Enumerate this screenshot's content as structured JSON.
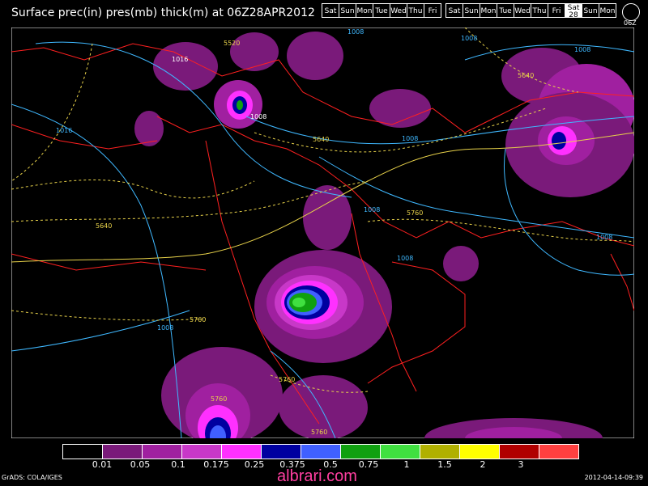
{
  "title": "Surface prec(in) pres(mb) thick(m) at 06Z28APR2012",
  "days": [
    {
      "label": "Sat",
      "current": false
    },
    {
      "label": "Sun",
      "current": false
    },
    {
      "label": "Mon",
      "current": false
    },
    {
      "label": "Tue",
      "current": false
    },
    {
      "label": "Wed",
      "current": false
    },
    {
      "label": "Thu",
      "current": false
    },
    {
      "label": "Fri",
      "current": false
    },
    {
      "label": "Sat",
      "current": false
    },
    {
      "label": "Sun",
      "current": false
    },
    {
      "label": "Mon",
      "current": false
    },
    {
      "label": "Tue",
      "current": false
    },
    {
      "label": "Wed",
      "current": false
    },
    {
      "label": "Thu",
      "current": false
    },
    {
      "label": "Fri",
      "current": false
    },
    {
      "label": "Sat",
      "current": true,
      "sub": "28"
    },
    {
      "label": "Sun",
      "current": false
    },
    {
      "label": "Mon",
      "current": false
    }
  ],
  "dial_label": "06Z",
  "map": {
    "isobar_labels": [
      "1016",
      "1016",
      "1008",
      "1008",
      "1008",
      "1008",
      "1008",
      "1008",
      "1008",
      "1008",
      "1008"
    ],
    "thickness_labels": [
      "5520",
      "5640",
      "5640",
      "5640",
      "5760",
      "5760",
      "5760",
      "5760",
      "5760"
    ],
    "colors": {
      "isobar": "#3fb8ff",
      "thickness": "#e8d24a",
      "coast": "#ff2020"
    }
  },
  "legend": {
    "colors": [
      "#000000",
      "#7a1a7a",
      "#a020a0",
      "#c838c8",
      "#ff30ff",
      "#0000a0",
      "#4060ff",
      "#10a010",
      "#40e040",
      "#b0b000",
      "#ffff00",
      "#b00000",
      "#ff4040"
    ],
    "labels": [
      "0.01",
      "0.05",
      "0.1",
      "0.175",
      "0.25",
      "0.375",
      "0.5",
      "0.75",
      "1",
      "1.5",
      "2",
      "3"
    ]
  },
  "footer": {
    "left": "GrADS: COLA/IGES",
    "right": "2012-04-14-09:39",
    "watermark": "albrari.com"
  }
}
